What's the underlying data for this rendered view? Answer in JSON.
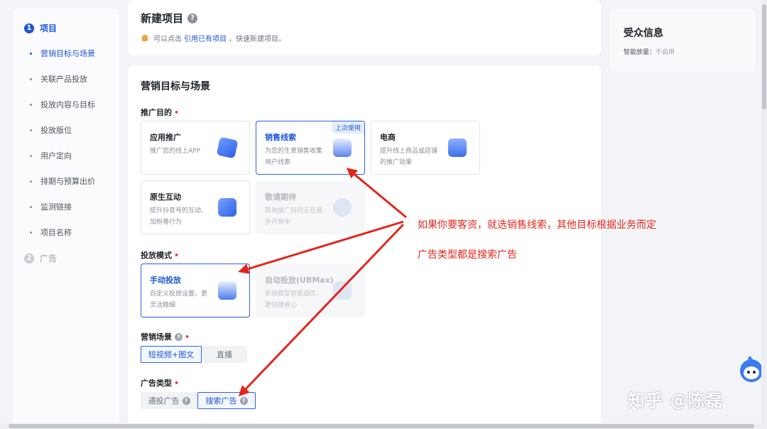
{
  "sidebar": {
    "step1": {
      "num": "1",
      "label": "项目"
    },
    "items": [
      "营销目标与场景",
      "关联产品投放",
      "投放内容与目标",
      "投放版位",
      "用户定向",
      "排期与预算出价",
      "监测链接",
      "项目名称"
    ],
    "step2": {
      "num": "2",
      "label": "广告"
    }
  },
  "header": {
    "title": "新建项目",
    "help": "?",
    "tip_prefix": "可以点击",
    "tip_link": "引用已有项目",
    "tip_suffix": "，快速新建项目。"
  },
  "main": {
    "title": "营销目标与场景",
    "goal_label": "推广目的",
    "required": "•",
    "goals": [
      {
        "title": "应用推广",
        "desc": "推广您的线上APP"
      },
      {
        "title": "销售线索",
        "desc": "为您的生意销售收集用户线索",
        "tag": "上次使用"
      },
      {
        "title": "电商",
        "desc": "提升线上商品或店铺的推广效果"
      },
      {
        "title": "原生互动",
        "desc": "提升抖音号的互动、加粉等行为"
      },
      {
        "title": "敬请期待",
        "desc": "其他推广目的正在逐步开放中"
      }
    ],
    "mode_label": "投放模式",
    "modes": [
      {
        "title": "手动投放",
        "desc": "自定义投放设置，更灵活精细"
      },
      {
        "title": "自动投放(UBMax)",
        "desc": "系统模型智能调优，更快捷省心"
      }
    ],
    "scene_label": "营销场景",
    "scenes": [
      "短视频+图文",
      "直播"
    ],
    "adtype_label": "广告类型",
    "adtypes": [
      "通投广告",
      "搜索广告"
    ]
  },
  "audience": {
    "title": "受众信息",
    "smart_label": "智能放量：",
    "smart_value": "不启用"
  },
  "annotations": {
    "line1": "如果你要客资，就选销售线索，其他目标根据业务而定",
    "line2": "广告类型都是搜索广告"
  },
  "watermark": "知乎 @陈磊",
  "colors": {
    "accent": "#1e56d8",
    "annotation": "#e3261c"
  }
}
